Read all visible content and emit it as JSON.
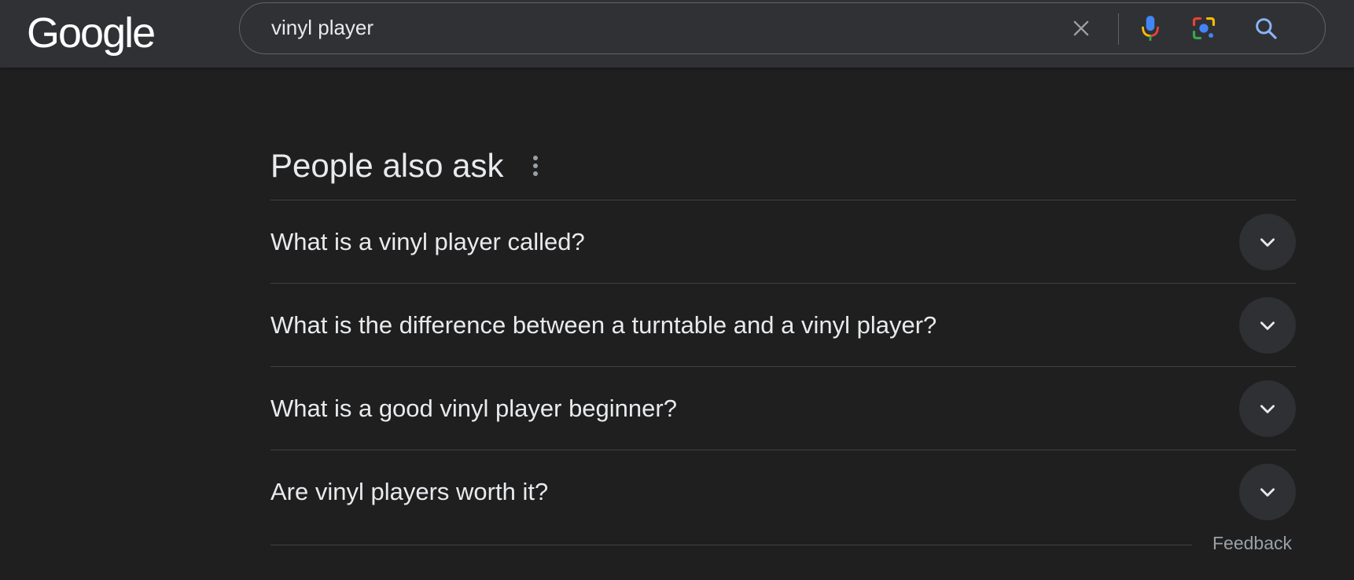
{
  "header": {
    "logo_text": "Google",
    "search": {
      "query": "vinyl player",
      "clear_icon": "close-icon",
      "voice_icon": "mic-icon",
      "lens_icon": "camera-lens-icon",
      "submit_icon": "search-icon"
    }
  },
  "people_also_ask": {
    "title": "People also ask",
    "menu_icon": "more-vert-icon",
    "questions": [
      {
        "text": "What is a vinyl player called?"
      },
      {
        "text": "What is the difference between a turntable and a vinyl player?"
      },
      {
        "text": "What is a good vinyl player beginner?"
      },
      {
        "text": "Are vinyl players worth it?"
      }
    ],
    "feedback_label": "Feedback"
  },
  "colors": {
    "background": "#1f1f1f",
    "header": "#303134",
    "text": "#e8eaed",
    "muted": "#9aa0a6",
    "divider": "#3c4043",
    "link_blue": "#8ab4f8"
  }
}
